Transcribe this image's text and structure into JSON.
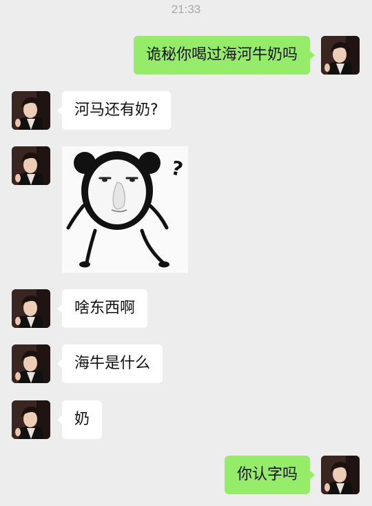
{
  "status": {
    "time": "21:33"
  },
  "messages": [
    {
      "id": "m1",
      "direction": "out",
      "type": "text",
      "text": "诡秘你喝过海河牛奶吗"
    },
    {
      "id": "m2",
      "direction": "in",
      "type": "text",
      "text": "河马还有奶?"
    },
    {
      "id": "m3",
      "direction": "in",
      "type": "sticker",
      "sticker": "confused-bear-sticker",
      "sticker_text": "?"
    },
    {
      "id": "m4",
      "direction": "in",
      "type": "text",
      "text": "啥东西啊"
    },
    {
      "id": "m5",
      "direction": "in",
      "type": "text",
      "text": "海牛是什么"
    },
    {
      "id": "m6",
      "direction": "in",
      "type": "text",
      "text": "奶"
    },
    {
      "id": "m7",
      "direction": "out",
      "type": "text",
      "text": "你认字吗"
    }
  ],
  "colors": {
    "background": "#ededed",
    "incoming_bubble": "#ffffff",
    "outgoing_bubble": "#95ec69",
    "timestamp": "#a8a8a8"
  },
  "icons": [
    "avatar-photo",
    "confused-bear-sticker"
  ]
}
